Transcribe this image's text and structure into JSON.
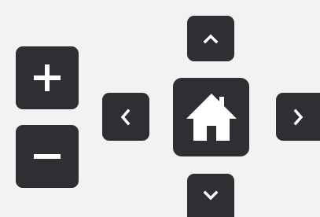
{
  "controls": {
    "zoom_in": {
      "icon": "plus-icon",
      "action": "Zoom in"
    },
    "zoom_out": {
      "icon": "minus-icon",
      "action": "Zoom out"
    },
    "pan_up": {
      "icon": "chevron-up-icon"
    },
    "pan_left": {
      "icon": "chevron-left-icon"
    },
    "home": {
      "icon": "home-icon"
    },
    "pan_right": {
      "icon": "chevron-right-icon"
    },
    "pan_down": {
      "icon": "chevron-down-icon"
    }
  },
  "colors": {
    "background": "#f2f2f3",
    "button": "#2e2e33",
    "icon": "#ffffff"
  }
}
